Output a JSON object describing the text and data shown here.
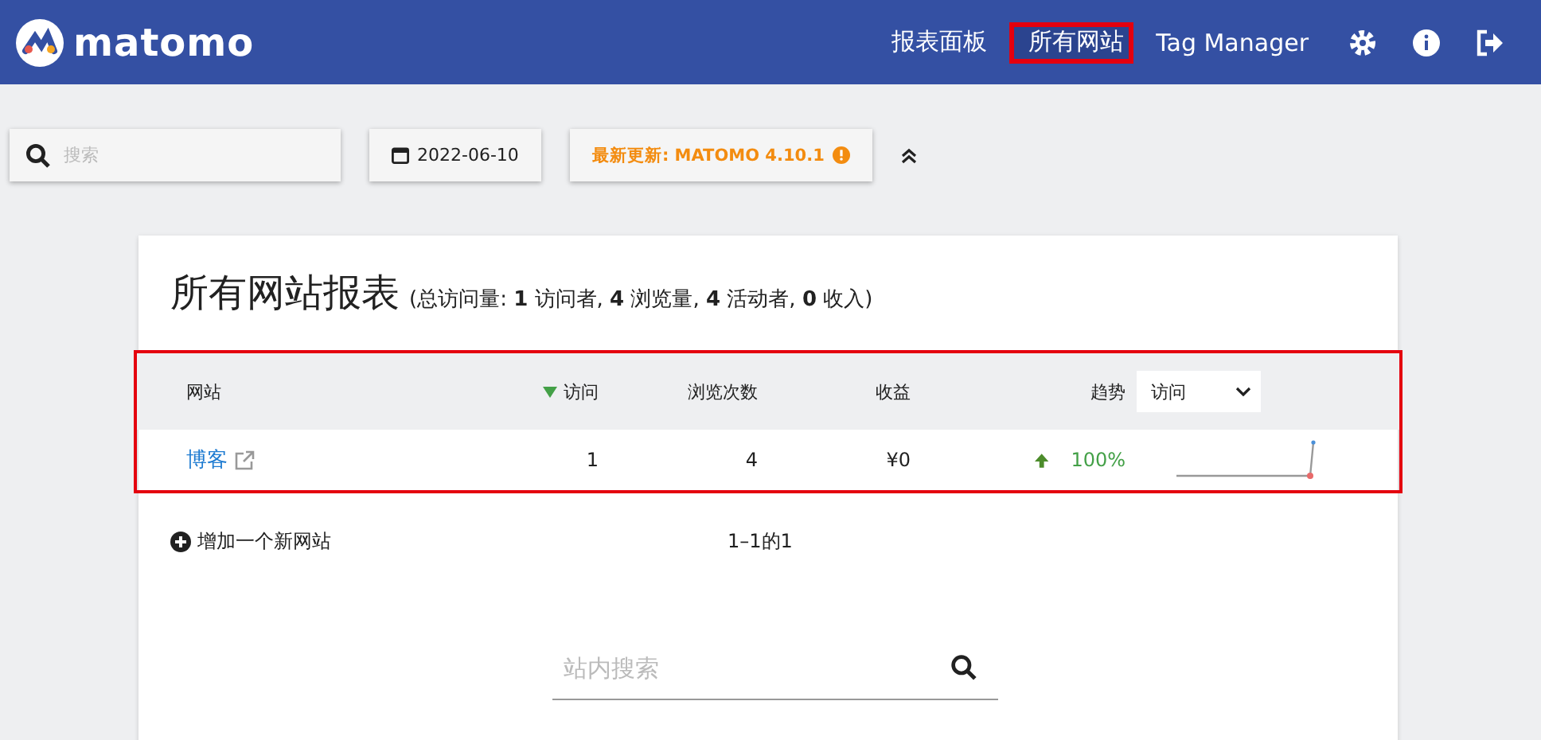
{
  "brand": {
    "name": "matomo"
  },
  "nav": [
    {
      "label": "报表面板",
      "selected": false,
      "highlighted": false
    },
    {
      "label": "所有网站",
      "selected": true,
      "highlighted": true
    },
    {
      "label": "Tag Manager",
      "selected": false,
      "highlighted": false
    }
  ],
  "nav_icons": [
    {
      "kind": "gear"
    },
    {
      "kind": "info"
    },
    {
      "kind": "logout"
    }
  ],
  "toolbar": {
    "search": {
      "placeholder": "搜索"
    },
    "date": "2022-06-10",
    "update": "最新更新: MATOMO 4.10.1"
  },
  "report": {
    "title": "所有网站报表",
    "summary": "(总访问量: **1** 访问者, **4** 浏览量, **4** 活动者, **0** 收入)",
    "highlighted": true,
    "columns": [
      {
        "label": "网站",
        "sorted": false
      },
      {
        "label": "访问",
        "sorted": true
      },
      {
        "label": "浏览次数",
        "sorted": false
      },
      {
        "label": "收益",
        "sorted": false
      }
    ],
    "trend_label": "趋势",
    "trend_select": "访问",
    "rows": [
      {
        "site": "博客",
        "visits": "1",
        "pageviews": "4",
        "revenue": "¥0",
        "trend_up": true,
        "trend": "100%"
      }
    ],
    "add_site": "增加一个新网站",
    "pagination": "1–1的1",
    "site_search": {
      "placeholder": "站内搜索"
    }
  }
}
